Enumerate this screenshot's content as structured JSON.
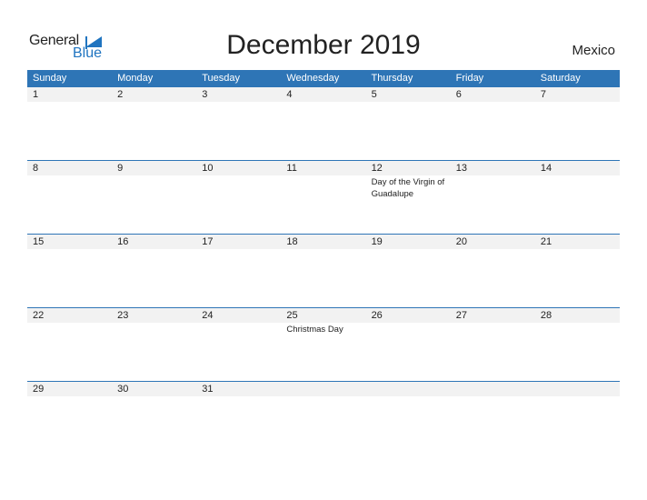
{
  "logo": {
    "general": "General",
    "blue": "Blue",
    "accent": "#1f74c0"
  },
  "title": "December 2019",
  "country": "Mexico",
  "colors": {
    "header": "#2e75b6",
    "band": "#f2f2f2"
  },
  "weekdays": [
    "Sunday",
    "Monday",
    "Tuesday",
    "Wednesday",
    "Thursday",
    "Friday",
    "Saturday"
  ],
  "weeks": [
    [
      {
        "day": "1"
      },
      {
        "day": "2"
      },
      {
        "day": "3"
      },
      {
        "day": "4"
      },
      {
        "day": "5"
      },
      {
        "day": "6"
      },
      {
        "day": "7"
      }
    ],
    [
      {
        "day": "8"
      },
      {
        "day": "9"
      },
      {
        "day": "10"
      },
      {
        "day": "11"
      },
      {
        "day": "12",
        "event": "Day of the Virgin of Guadalupe"
      },
      {
        "day": "13"
      },
      {
        "day": "14"
      }
    ],
    [
      {
        "day": "15"
      },
      {
        "day": "16"
      },
      {
        "day": "17"
      },
      {
        "day": "18"
      },
      {
        "day": "19"
      },
      {
        "day": "20"
      },
      {
        "day": "21"
      }
    ],
    [
      {
        "day": "22"
      },
      {
        "day": "23"
      },
      {
        "day": "24"
      },
      {
        "day": "25",
        "event": "Christmas Day"
      },
      {
        "day": "26"
      },
      {
        "day": "27"
      },
      {
        "day": "28"
      }
    ],
    [
      {
        "day": "29"
      },
      {
        "day": "30"
      },
      {
        "day": "31"
      },
      {
        "day": ""
      },
      {
        "day": ""
      },
      {
        "day": ""
      },
      {
        "day": ""
      }
    ]
  ]
}
